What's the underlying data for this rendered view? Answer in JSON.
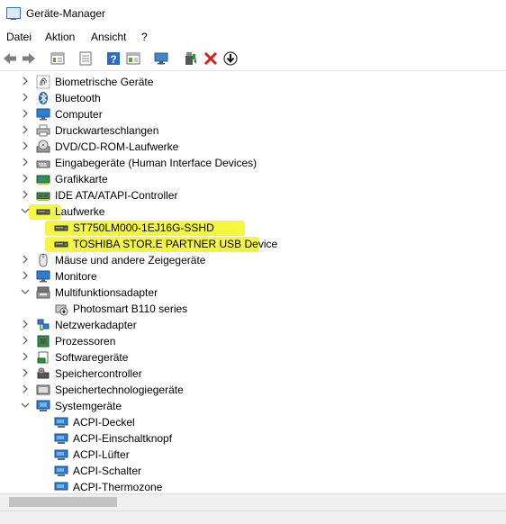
{
  "window": {
    "title": "Geräte-Manager"
  },
  "menu": [
    "Datei",
    "Aktion",
    "Ansicht",
    "?"
  ],
  "toolbar": [
    "back-arrow-icon",
    "forward-arrow-icon",
    "properties-icon",
    "update-driver-icon",
    "help-icon",
    "view-icon",
    "monitor-icon",
    "enable-device-icon",
    "uninstall-icon",
    "download-icon"
  ],
  "tree": [
    {
      "label": "Biometrische Geräte",
      "level": 0,
      "expanded": false,
      "icon": "fingerprint-icon"
    },
    {
      "label": "Bluetooth",
      "level": 0,
      "expanded": false,
      "icon": "bluetooth-icon"
    },
    {
      "label": "Computer",
      "level": 0,
      "expanded": false,
      "icon": "computer-icon"
    },
    {
      "label": "Druckwarteschlangen",
      "level": 0,
      "expanded": false,
      "icon": "printer-icon"
    },
    {
      "label": "DVD/CD-ROM-Laufwerke",
      "level": 0,
      "expanded": false,
      "icon": "dvd-drive-icon"
    },
    {
      "label": "Eingabegeräte (Human Interface Devices)",
      "level": 0,
      "expanded": false,
      "icon": "hid-icon"
    },
    {
      "label": "Grafikkarte",
      "level": 0,
      "expanded": false,
      "icon": "graphics-card-icon"
    },
    {
      "label": "IDE ATA/ATAPI-Controller",
      "level": 0,
      "expanded": false,
      "icon": "ide-controller-icon"
    },
    {
      "label": "Laufwerke",
      "level": 0,
      "expanded": true,
      "icon": "disk-drive-icon",
      "highlight": true
    },
    {
      "label": "ST750LM000-1EJ16G-SSHD",
      "level": 1,
      "icon": "disk-drive-icon",
      "highlight": true
    },
    {
      "label": "TOSHIBA STOR.E PARTNER USB Device",
      "level": 1,
      "icon": "disk-drive-icon",
      "highlight": true
    },
    {
      "label": "Mäuse und andere Zeigegeräte",
      "level": 0,
      "expanded": false,
      "icon": "mouse-icon"
    },
    {
      "label": "Monitore",
      "level": 0,
      "expanded": false,
      "icon": "monitor-icon"
    },
    {
      "label": "Multifunktionsadapter",
      "level": 0,
      "expanded": true,
      "icon": "multifunction-icon"
    },
    {
      "label": "Photosmart B110 series",
      "level": 1,
      "icon": "device-warning-icon"
    },
    {
      "label": "Netzwerkadapter",
      "level": 0,
      "expanded": false,
      "icon": "network-adapter-icon"
    },
    {
      "label": "Prozessoren",
      "level": 0,
      "expanded": false,
      "icon": "processor-icon"
    },
    {
      "label": "Softwaregeräte",
      "level": 0,
      "expanded": false,
      "icon": "software-device-icon"
    },
    {
      "label": "Speichercontroller",
      "level": 0,
      "expanded": false,
      "icon": "storage-controller-icon"
    },
    {
      "label": "Speichertechnologiegeräte",
      "level": 0,
      "expanded": false,
      "icon": "storage-tech-icon"
    },
    {
      "label": "Systemgeräte",
      "level": 0,
      "expanded": true,
      "icon": "system-devices-icon"
    },
    {
      "label": "ACPI-Deckel",
      "level": 1,
      "icon": "system-device-icon"
    },
    {
      "label": "ACPI-Einschaltknopf",
      "level": 1,
      "icon": "system-device-icon"
    },
    {
      "label": "ACPI-Lüfter",
      "level": 1,
      "icon": "system-device-icon"
    },
    {
      "label": "ACPI-Schalter",
      "level": 1,
      "icon": "system-device-icon"
    },
    {
      "label": "ACPI-Thermozone",
      "level": 1,
      "icon": "system-device-icon"
    }
  ],
  "colors": {
    "highlight": "#f2f51e",
    "uninstall": "#e01b1b",
    "blue": "#2b6cc4"
  }
}
